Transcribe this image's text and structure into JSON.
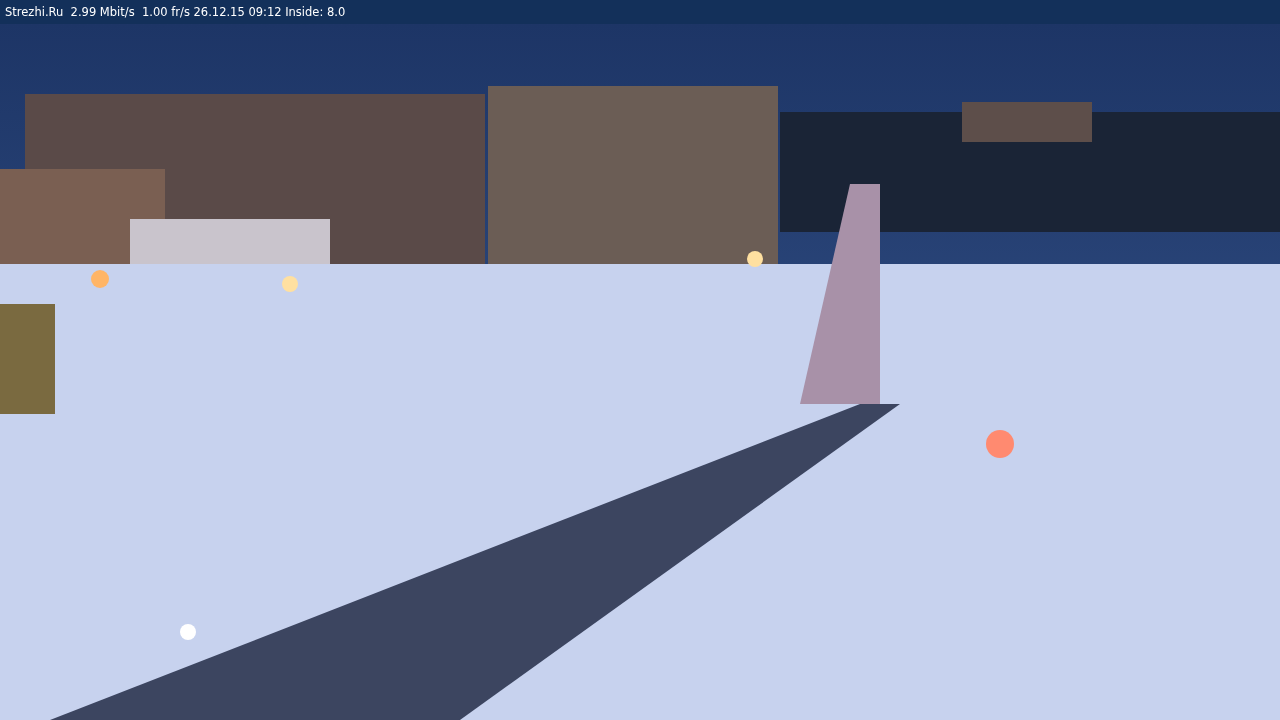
{
  "status_bar": {
    "text": "Strezhi.Ru  2.99 Mbit/s  1.00 fr/s 26.12.15 09:12 Inside: 8.0"
  }
}
